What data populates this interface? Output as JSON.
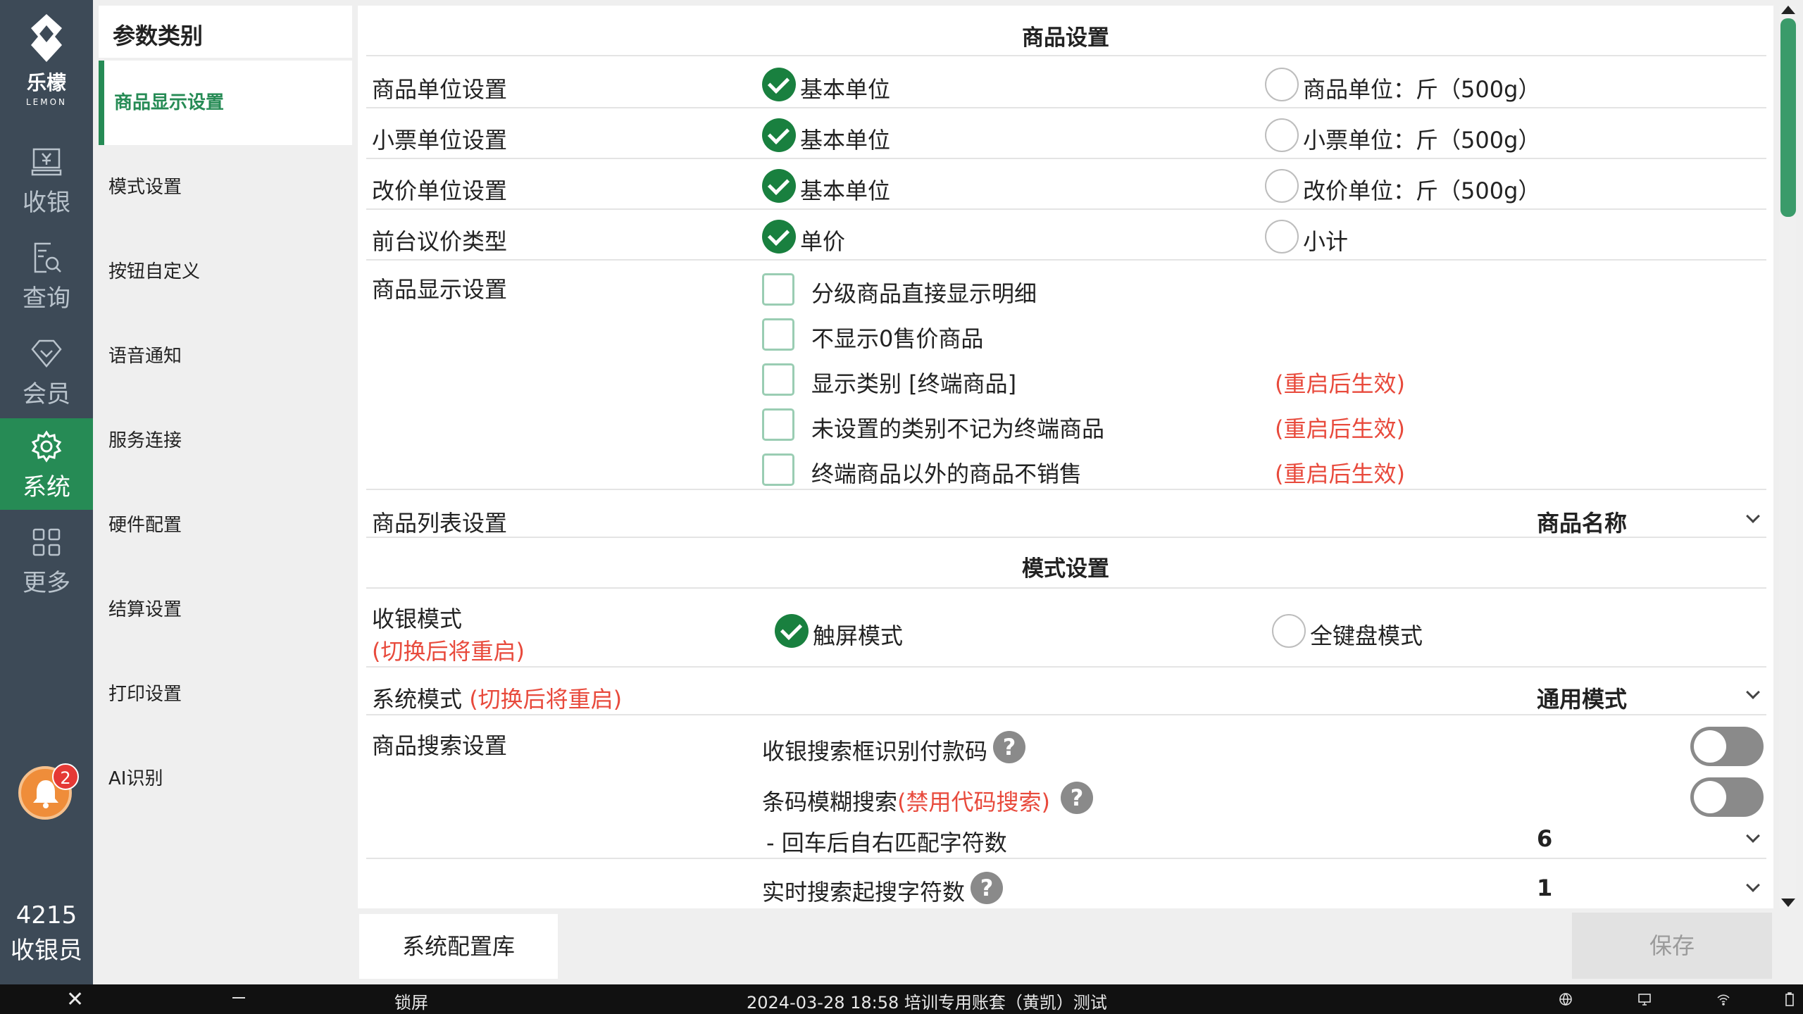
{
  "logo": {
    "cn": "乐檬",
    "en": "LEMON"
  },
  "rail": {
    "items": [
      {
        "label": "收银",
        "icon": "cashier-icon"
      },
      {
        "label": "查询",
        "icon": "search-doc-icon"
      },
      {
        "label": "会员",
        "icon": "diamond-icon"
      },
      {
        "label": "系统",
        "icon": "gear-icon",
        "active": true
      },
      {
        "label": "更多",
        "icon": "grid-icon"
      }
    ],
    "notification_count": "2",
    "user_id": "4215",
    "user_role": "收银员"
  },
  "categories": {
    "title": "参数类别",
    "items": [
      "商品显示设置",
      "模式设置",
      "按钮自定义",
      "语音通知",
      "服务连接",
      "硬件配置",
      "结算设置",
      "打印设置",
      "AI识别"
    ],
    "active": "商品显示设置"
  },
  "goods": {
    "title": "商品设置",
    "unit": {
      "label": "商品单位设置",
      "opt1": "基本单位",
      "opt2": "商品单位：斤（500g）"
    },
    "ticket": {
      "label": "小票单位设置",
      "opt1": "基本单位",
      "opt2": "小票单位：斤（500g）"
    },
    "price": {
      "label": "改价单位设置",
      "opt1": "基本单位",
      "opt2": "改价单位：斤（500g）"
    },
    "bargain": {
      "label": "前台议价类型",
      "opt1": "单价",
      "opt2": "小计"
    },
    "display": {
      "label": "商品显示设置",
      "options": [
        {
          "text": "分级商品直接显示明细",
          "note": ""
        },
        {
          "text": "不显示0售价商品",
          "note": ""
        },
        {
          "text": "显示类别 [终端商品]",
          "note": "(重启后生效)"
        },
        {
          "text": "未设置的类别不记为终端商品",
          "note": "(重启后生效)"
        },
        {
          "text": "终端商品以外的商品不销售",
          "note": "(重启后生效)"
        }
      ]
    },
    "list": {
      "label": "商品列表设置",
      "value": "商品名称"
    }
  },
  "mode": {
    "title": "模式设置",
    "cashier": {
      "label": "收银模式",
      "note": "(切换后将重启)",
      "opt1": "触屏模式",
      "opt2": "全键盘模式"
    },
    "system": {
      "label": "系统模式",
      "note": "(切换后将重启)",
      "value": "通用模式"
    },
    "search": {
      "label": "商品搜索设置",
      "paycode": "收银搜索框识别付款码",
      "fuzzy": "条码模糊搜索",
      "fuzzy_note": "(禁用代码搜索)",
      "match": "- 回车后自右匹配字符数",
      "match_value": "6",
      "realtime": "实时搜索起搜字符数",
      "realtime_value": "1"
    }
  },
  "buttons": {
    "config_lib": "系统配置库",
    "save": "保存"
  },
  "taskbar": {
    "lock": "锁屏",
    "status": "2024-03-28 18:58 培训专用账套（黄凯）测试"
  },
  "colors": {
    "accent": "#268b55",
    "rail": "#3d4a57",
    "warning": "#e84a3c"
  }
}
